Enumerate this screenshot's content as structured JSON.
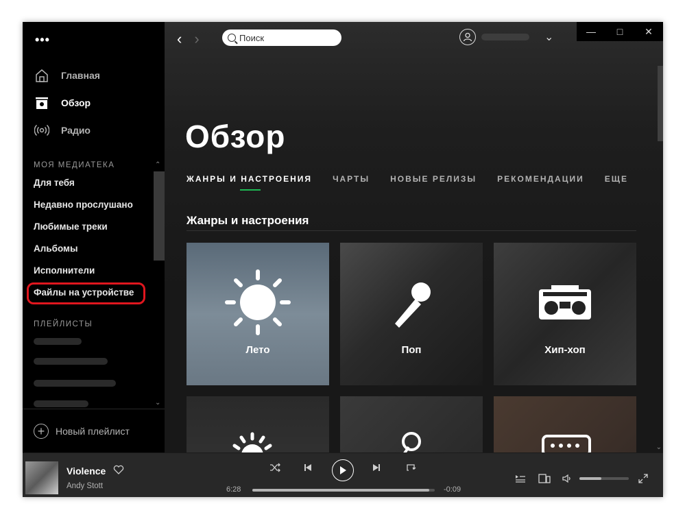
{
  "sidebar": {
    "menu_dots": "•••",
    "nav": [
      {
        "label": "Главная",
        "icon": "home-icon"
      },
      {
        "label": "Обзор",
        "icon": "browse-icon"
      },
      {
        "label": "Радио",
        "icon": "radio-icon"
      }
    ],
    "library_label": "МОЯ МЕДИАТЕКА",
    "library": [
      "Для тебя",
      "Недавно прослушано",
      "Любимые треки",
      "Альбомы",
      "Исполнители",
      "Файлы на устройстве"
    ],
    "playlists_label": "ПЛЕЙЛИСТЫ",
    "new_playlist": "Новый плейлист"
  },
  "topbar": {
    "search_placeholder": "Поиск"
  },
  "main": {
    "title": "Обзор",
    "tabs": [
      "ЖАНРЫ И НАСТРОЕНИЯ",
      "ЧАРТЫ",
      "НОВЫЕ РЕЛИЗЫ",
      "РЕКОМЕНДАЦИИ",
      "ЕЩЕ"
    ],
    "section_title": "Жанры и настроения",
    "tiles": [
      {
        "label": "Лето",
        "icon": "sun-icon"
      },
      {
        "label": "Поп",
        "icon": "microphone-icon"
      },
      {
        "label": "Хип-хоп",
        "icon": "boombox-icon"
      }
    ]
  },
  "player": {
    "track": "Violence",
    "artist": "Andy Stott",
    "elapsed": "6:28",
    "remaining": "-0:09",
    "progress": 0.97,
    "volume": 0.45
  },
  "colors": {
    "accent": "#1db954",
    "highlight": "#e0161e"
  }
}
